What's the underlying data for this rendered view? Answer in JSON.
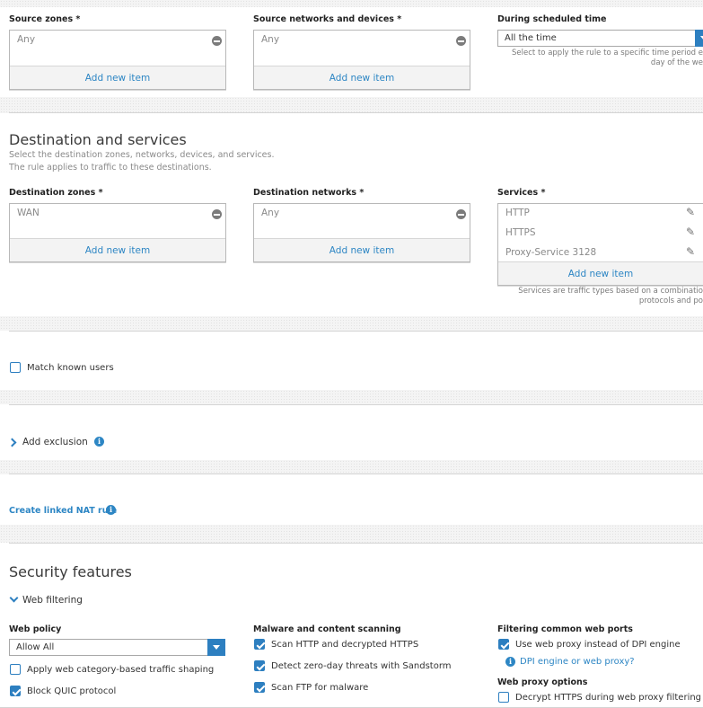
{
  "source": {
    "zones_label": "Source zones *",
    "zones_items": [
      "Any"
    ],
    "networks_label": "Source networks and devices *",
    "networks_items": [
      "Any"
    ],
    "add_new_item": "Add new item",
    "schedule_label": "During scheduled time",
    "schedule_value": "All the time",
    "schedule_hint_line1": "Select to apply the rule to a specific time period e",
    "schedule_hint_line2": "day of the we"
  },
  "destination": {
    "title": "Destination and services",
    "desc_line1": "Select the destination zones, networks, devices, and services.",
    "desc_line2": "The rule applies to traffic to these destinations.",
    "zones_label": "Destination zones *",
    "zones_items": [
      "WAN"
    ],
    "networks_label": "Destination networks *",
    "networks_items": [
      "Any"
    ],
    "services_label": "Services *",
    "services_items": [
      "HTTP",
      "HTTPS",
      "Proxy-Service 3128"
    ],
    "add_new_item": "Add new item",
    "services_hint_line1": "Services are traffic types based on a combinatio",
    "services_hint_line2": "protocols and po"
  },
  "match_known_users": {
    "label": "Match known users",
    "checked": false
  },
  "exclusion": {
    "label": "Add exclusion",
    "info_icon": "info-icon"
  },
  "nat": {
    "label": "Create linked NAT rule",
    "info_icon": "info-icon"
  },
  "security": {
    "title": "Security features",
    "web_filtering_label": "Web filtering",
    "web_policy": {
      "label": "Web policy",
      "value": "Allow All",
      "shaping_label": "Apply web category-based traffic shaping",
      "shaping_checked": false,
      "quic_label": "Block QUIC protocol",
      "quic_checked": true
    },
    "malware": {
      "label": "Malware and content scanning",
      "items": [
        {
          "label": "Scan HTTP and decrypted HTTPS",
          "checked": true
        },
        {
          "label": "Detect zero-day threats with Sandstorm",
          "checked": true
        },
        {
          "label": "Scan FTP for malware",
          "checked": true
        }
      ]
    },
    "ports": {
      "label": "Filtering common web ports",
      "use_proxy_label": "Use web proxy instead of DPI engine",
      "use_proxy_checked": true,
      "dpi_link": "DPI engine or web proxy?",
      "proxy_options_label": "Web proxy options",
      "decrypt_label": "Decrypt HTTPS during web proxy filtering",
      "decrypt_checked": false
    }
  },
  "colors": {
    "accent": "#2d7fc0",
    "link": "#2d86c4",
    "band": "#f4f4f4"
  }
}
